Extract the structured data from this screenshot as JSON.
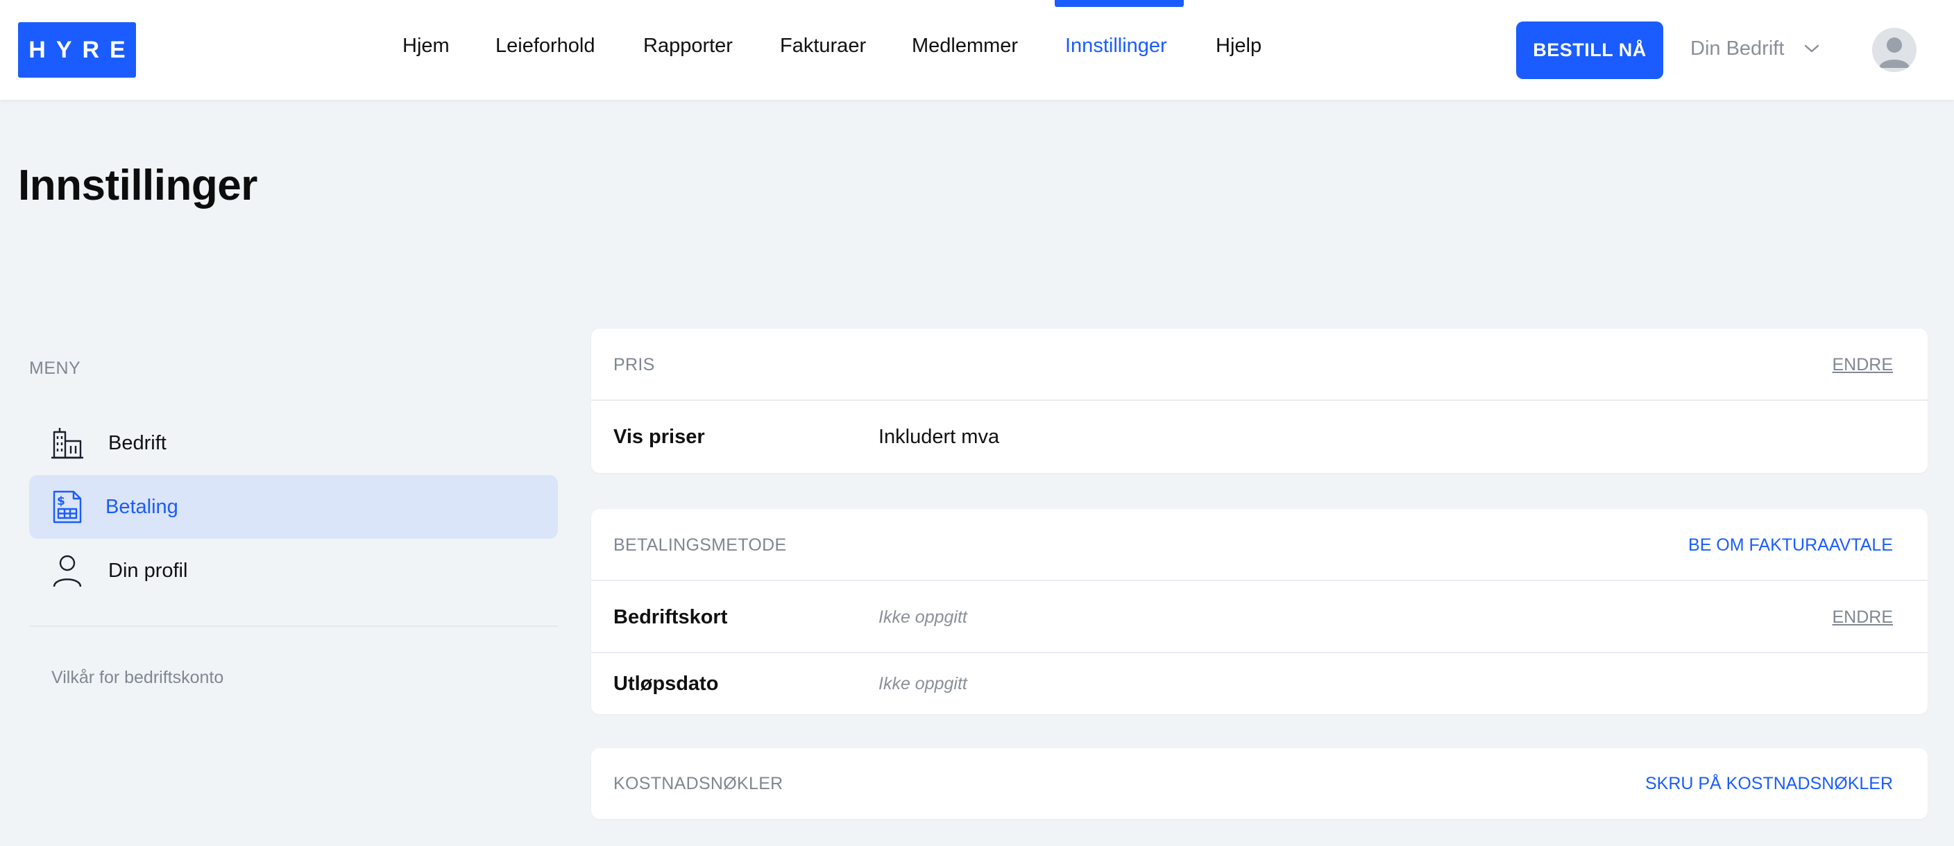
{
  "header": {
    "logo_text": "HYRE",
    "nav": [
      {
        "label": "Hjem"
      },
      {
        "label": "Leieforhold"
      },
      {
        "label": "Rapporter"
      },
      {
        "label": "Fakturaer"
      },
      {
        "label": "Medlemmer"
      },
      {
        "label": "Innstillinger",
        "active": true
      },
      {
        "label": "Hjelp"
      }
    ],
    "order_button": "BESTILL NÅ",
    "company_select": "Din Bedrift"
  },
  "page": {
    "title": "Innstillinger"
  },
  "sidebar": {
    "heading": "MENY",
    "items": [
      {
        "label": "Bedrift",
        "icon": "building-icon"
      },
      {
        "label": "Betaling",
        "icon": "invoice-icon",
        "active": true
      },
      {
        "label": "Din profil",
        "icon": "person-icon"
      }
    ],
    "terms_link": "Vilkår for bedriftskonto"
  },
  "cards": {
    "price": {
      "title": "PRIS",
      "action": "ENDRE",
      "rows": [
        {
          "label": "Vis priser",
          "value": "Inkludert mva"
        }
      ]
    },
    "payment": {
      "title": "BETALINGSMETODE",
      "action": "BE OM FAKTURAAVTALE",
      "rows": [
        {
          "label": "Bedriftskort",
          "value": "Ikke oppgitt",
          "action": "ENDRE"
        },
        {
          "label": "Utløpsdato",
          "value": "Ikke oppgitt"
        }
      ]
    },
    "cost_keys": {
      "title": "KOSTNADSNØKLER",
      "action": "SKRU PÅ KOSTNADSNØKLER"
    }
  },
  "colors": {
    "accent": "#1a5cff",
    "background": "#f1f4f7",
    "active_menu_bg": "#dbe5f9",
    "muted_text": "#7f8792"
  }
}
